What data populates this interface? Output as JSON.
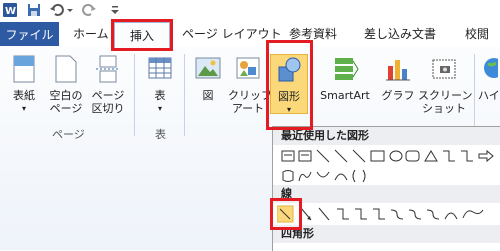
{
  "tabs": {
    "file": "ファイル",
    "home": "ホーム",
    "insert": "挿入",
    "page_layout": "ページ レイアウト",
    "references": "参考資料",
    "mailings": "差し込み文書",
    "review": "校閲"
  },
  "ribbon": {
    "cover_page": "表紙",
    "blank_page": [
      "空白の",
      "ページ"
    ],
    "page_break": [
      "ページ",
      "区切り"
    ],
    "pages_group": "ページ",
    "table": "表",
    "tables_group": "表",
    "picture": "図",
    "clip_art": [
      "クリップ",
      "アート"
    ],
    "shapes": "図形",
    "smartart": "SmartArt",
    "chart": "グラフ",
    "screenshot": [
      "スクリーン",
      "ショット"
    ],
    "hyperlink": "ハイパ"
  },
  "shapes_dropdown": {
    "recent_header": "最近使用した図形",
    "lines_header": "線",
    "rectangles_header": "四角形"
  },
  "colors": {
    "file_tab": "#2d5aa3",
    "highlight": "#e41b22"
  }
}
